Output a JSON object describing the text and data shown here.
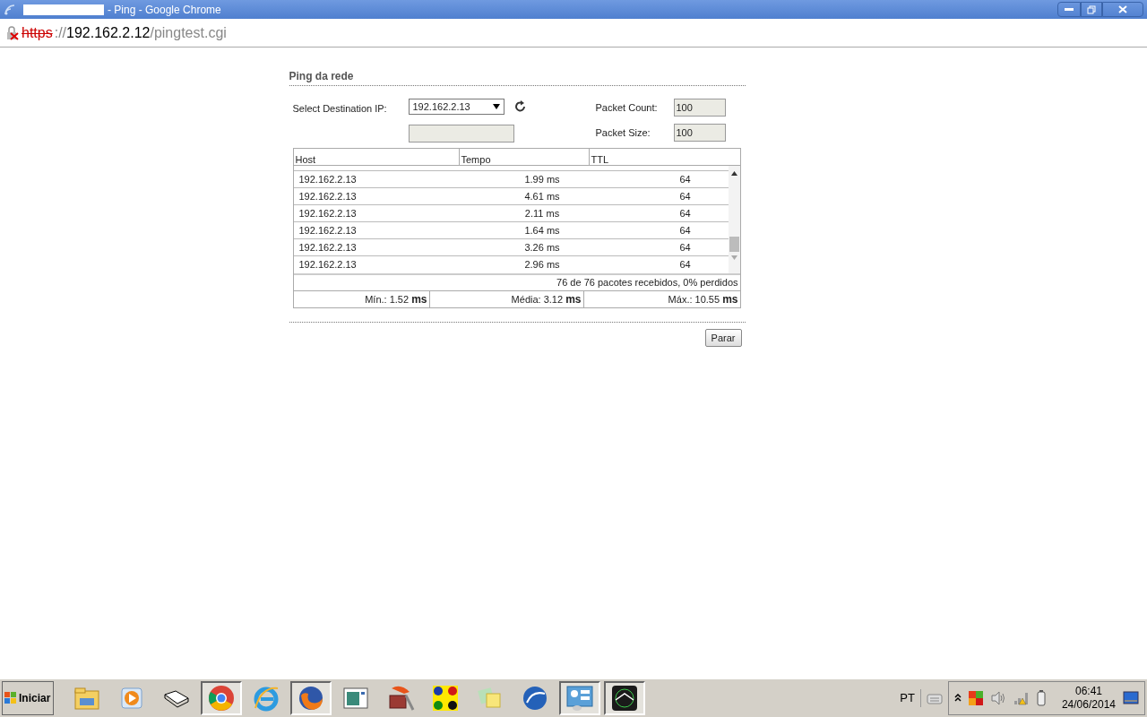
{
  "window": {
    "title": "- Ping - Google Chrome"
  },
  "address_bar": {
    "scheme": "https",
    "separator": "://",
    "host": "192.162.2.12",
    "path": "/pingtest.cgi"
  },
  "panel": {
    "title": "Ping da rede",
    "destination": {
      "label": "Select Destination IP:",
      "value": "192.162.2.13"
    },
    "packet_count": {
      "label": "Packet Count:",
      "value": "100"
    },
    "packet_size": {
      "label": "Packet Size:",
      "value": "100"
    },
    "table": {
      "columns": [
        "Host",
        "Tempo",
        "TTL"
      ],
      "rows": [
        {
          "host": "192.162.2.13",
          "time": "1.99 ms",
          "ttl": "64"
        },
        {
          "host": "192.162.2.13",
          "time": "4.61 ms",
          "ttl": "64"
        },
        {
          "host": "192.162.2.13",
          "time": "2.11 ms",
          "ttl": "64"
        },
        {
          "host": "192.162.2.13",
          "time": "1.64 ms",
          "ttl": "64"
        },
        {
          "host": "192.162.2.13",
          "time": "3.26 ms",
          "ttl": "64"
        },
        {
          "host": "192.162.2.13",
          "time": "2.96 ms",
          "ttl": "64"
        }
      ]
    },
    "summary": "76 de 76 pacotes recebidos, 0% perdidos",
    "stats": [
      {
        "label": "Mín.: 1.52",
        "unit": "ms"
      },
      {
        "label": "Média: 3.12",
        "unit": "ms"
      },
      {
        "label": "Máx.: 10.55",
        "unit": "ms"
      }
    ],
    "button": "Parar"
  },
  "taskbar": {
    "start": "Iniciar",
    "items": [
      {
        "kind": "folder",
        "open": false
      },
      {
        "kind": "media",
        "open": false
      },
      {
        "kind": "book",
        "open": false
      },
      {
        "kind": "chrome",
        "open": true
      },
      {
        "kind": "ie",
        "open": false
      },
      {
        "kind": "firefox",
        "open": true
      },
      {
        "kind": "window",
        "open": false
      },
      {
        "kind": "firewall",
        "open": false
      },
      {
        "kind": "dots",
        "open": false
      },
      {
        "kind": "notes",
        "open": false
      },
      {
        "kind": "winbox",
        "open": false
      },
      {
        "kind": "panel",
        "open": true
      },
      {
        "kind": "radar",
        "open": true
      }
    ],
    "language": "PT",
    "time": "06:41",
    "date": "24/06/2014"
  }
}
